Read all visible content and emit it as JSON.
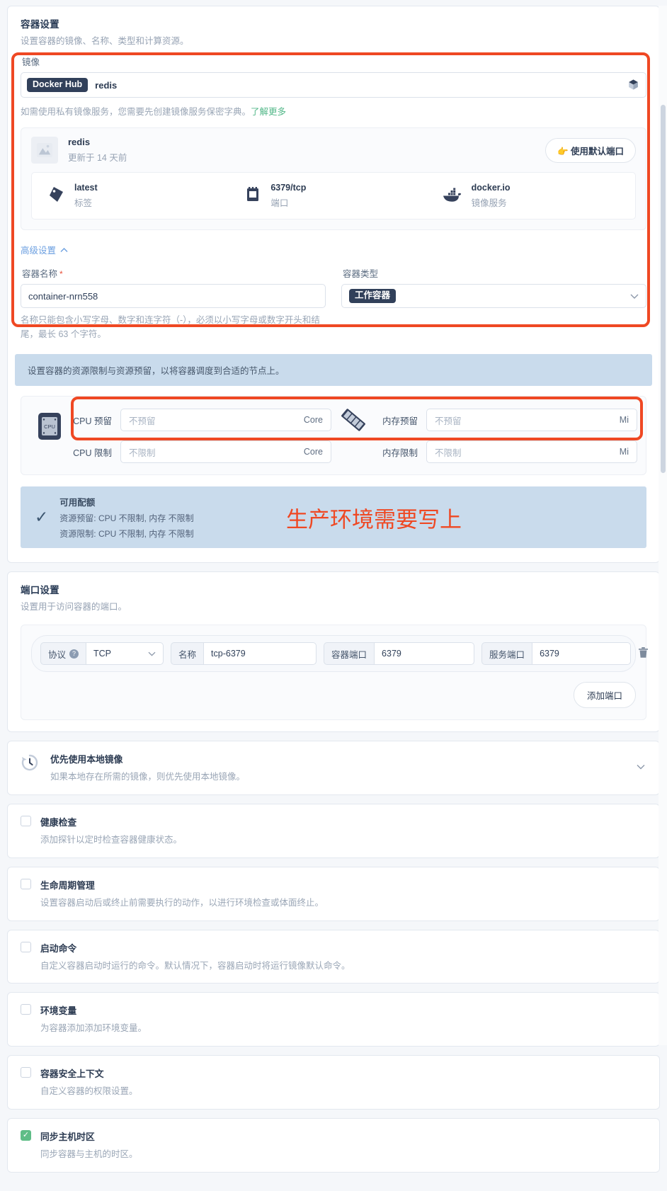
{
  "container_settings": {
    "title": "容器设置",
    "subtitle": "设置容器的镜像、名称、类型和计算资源。",
    "image_label": "镜像",
    "registry_badge": "Docker Hub",
    "image_value": "redis",
    "private_hint": "如需使用私有镜像服务，您需要先创建镜像服务保密字典。",
    "private_hint_link": "了解更多",
    "image_preview": {
      "name": "redis",
      "updated": "更新于 14 天前",
      "default_port_button": "👉 使用默认端口",
      "stats": [
        {
          "value": "latest",
          "label": "标签",
          "icon": "tag-icon"
        },
        {
          "value": "6379/tcp",
          "label": "端口",
          "icon": "port-icon"
        },
        {
          "value": "docker.io",
          "label": "镜像服务",
          "icon": "docker-icon"
        }
      ]
    },
    "advanced_toggle": "高级设置",
    "container_name_label": "容器名称",
    "container_name_required": "*",
    "container_name_value": "container-nrn558",
    "container_name_help": "名称只能包含小写字母、数字和连字符（-），必须以小写字母或数字开头和结尾，最长 63 个字符。",
    "container_type_label": "容器类型",
    "container_type_value": "工作容器"
  },
  "resources": {
    "banner": "设置容器的资源限制与资源预留，以将容器调度到合适的节点上。",
    "cpu_icon_label": "CPU",
    "rows": [
      {
        "left_label": "CPU 预留",
        "left_placeholder": "不预留",
        "left_unit": "Core",
        "right_label": "内存预留",
        "right_placeholder": "不预留",
        "right_unit": "Mi"
      },
      {
        "left_label": "CPU 限制",
        "left_placeholder": "不限制",
        "left_unit": "Core",
        "right_label": "内存限制",
        "right_placeholder": "不限制",
        "right_unit": "Mi"
      }
    ],
    "quota": {
      "title": "可用配额",
      "line1": "资源预留: CPU 不限制, 内存 不限制",
      "line2": "资源限制: CPU 不限制, 内存 不限制"
    }
  },
  "annotations": {
    "note_text": "生产环境需要写上",
    "note_color": "#ef4823",
    "box_color": "#ef4823"
  },
  "ports": {
    "title": "端口设置",
    "subtitle": "设置用于访问容器的端口。",
    "row": {
      "protocol_label": "协议",
      "protocol_value": "TCP",
      "name_label": "名称",
      "name_value": "tcp-6379",
      "container_port_label": "容器端口",
      "container_port_value": "6379",
      "service_port_label": "服务端口",
      "service_port_value": "6379"
    },
    "add_button": "添加端口"
  },
  "sections": [
    {
      "icon": "history-icon",
      "title": "优先使用本地镜像",
      "subtitle": "如果本地存在所需的镜像，则优先使用本地镜像。",
      "type": "collapsible",
      "checked": false
    },
    {
      "icon": "checkbox",
      "title": "健康检查",
      "subtitle": "添加探针以定时检查容器健康状态。",
      "type": "checkbox",
      "checked": false
    },
    {
      "icon": "checkbox",
      "title": "生命周期管理",
      "subtitle": "设置容器启动后或终止前需要执行的动作，以进行环境检查或体面终止。",
      "type": "checkbox",
      "checked": false
    },
    {
      "icon": "checkbox",
      "title": "启动命令",
      "subtitle": "自定义容器启动时运行的命令。默认情况下，容器启动时将运行镜像默认命令。",
      "type": "checkbox",
      "checked": false
    },
    {
      "icon": "checkbox",
      "title": "环境变量",
      "subtitle": "为容器添加添加环境变量。",
      "type": "checkbox",
      "checked": false
    },
    {
      "icon": "checkbox",
      "title": "容器安全上下文",
      "subtitle": "自定义容器的权限设置。",
      "type": "checkbox",
      "checked": false
    },
    {
      "icon": "checkbox",
      "title": "同步主机时区",
      "subtitle": "同步容器与主机的时区。",
      "type": "checkbox",
      "checked": true
    }
  ]
}
